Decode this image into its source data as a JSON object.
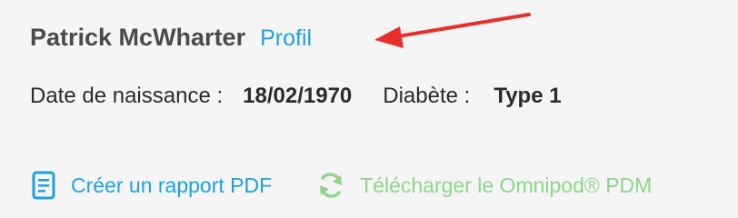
{
  "patient": {
    "name": "Patrick McWharter",
    "profile_link": "Profil"
  },
  "info": {
    "dob_label": "Date de naissance :",
    "dob_value": "18/02/1970",
    "diabetes_label": "Diabète :",
    "diabetes_value": "Type 1"
  },
  "actions": {
    "pdf_label": "Créer un rapport PDF",
    "pdf_icon": "document-icon",
    "pdm_label": "Télécharger le Omnipod® PDM",
    "pdm_icon": "sync-icon"
  },
  "annotation": {
    "arrow_icon": "red-arrow-icon"
  },
  "colors": {
    "link": "#1da1e2",
    "disabled_action": "#8ed58b",
    "arrow": "#e8302a",
    "name_text": "#4a4a4a"
  }
}
